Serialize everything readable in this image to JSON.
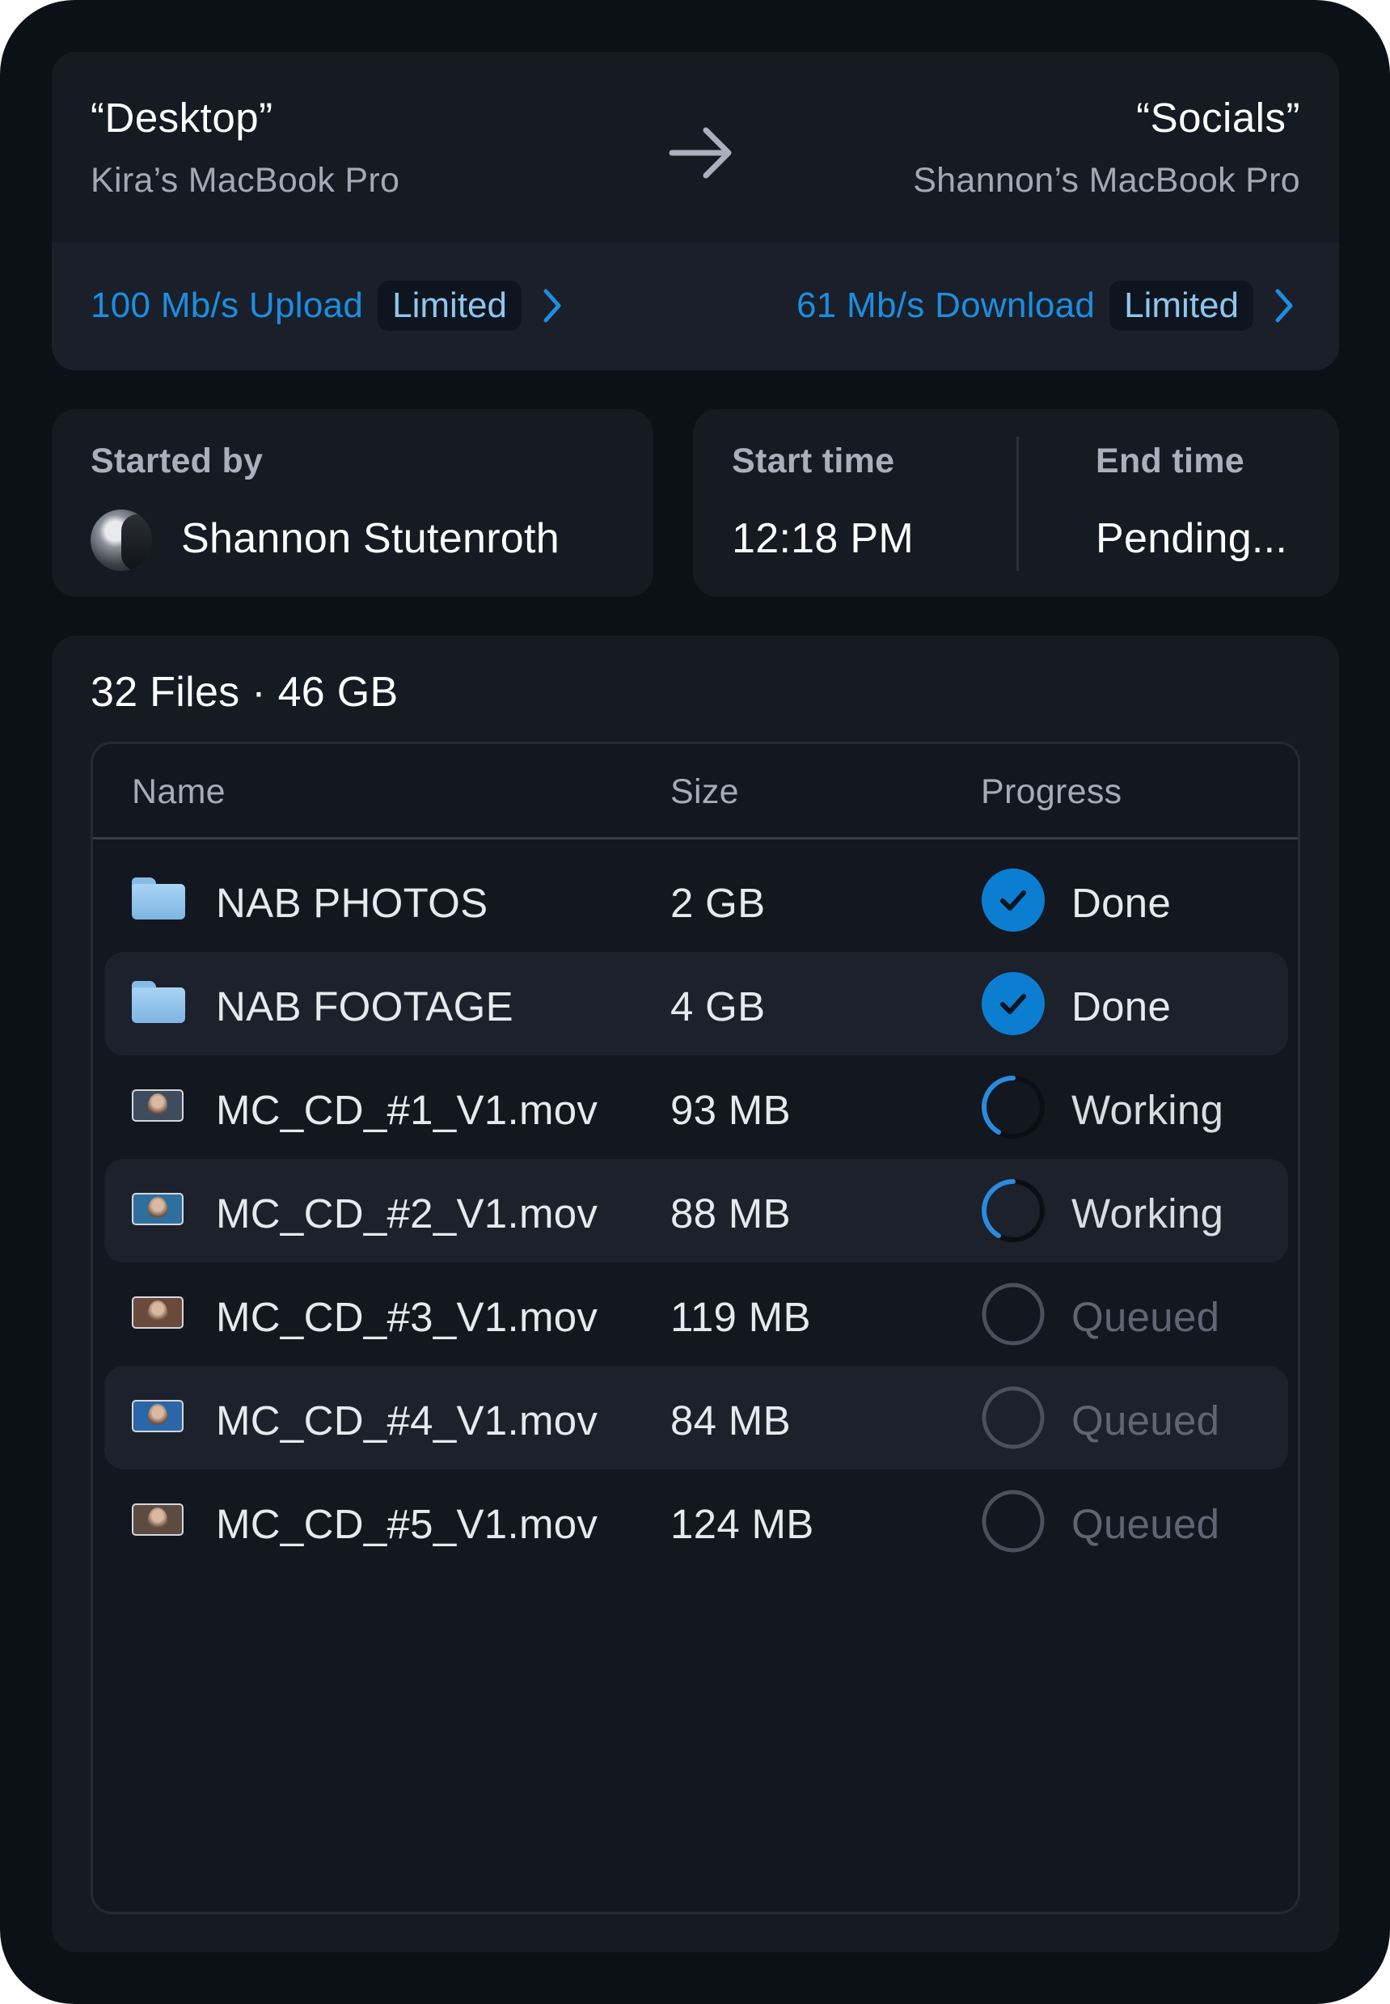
{
  "transfer": {
    "source": {
      "title": "“Desktop”",
      "device": "Kira’s MacBook Pro"
    },
    "destination": {
      "title": "“Socials”",
      "device": "Shannon’s MacBook Pro"
    },
    "upload": {
      "speed": "100 Mb/s Upload",
      "badge": "Limited"
    },
    "download": {
      "speed": "61 Mb/s Download",
      "badge": "Limited"
    }
  },
  "started_by": {
    "label": "Started by",
    "name": "Shannon Stutenroth"
  },
  "times": {
    "start_label": "Start time",
    "start_value": "12:18 PM",
    "end_label": "End time",
    "end_value": "Pending..."
  },
  "files": {
    "summary": "32 Files · 46 GB",
    "columns": {
      "name": "Name",
      "size": "Size",
      "progress": "Progress"
    },
    "rows": [
      {
        "name": "NAB PHOTOS",
        "size": "2 GB",
        "status": "Done",
        "kind": "folder",
        "state": "done"
      },
      {
        "name": "NAB FOOTAGE",
        "size": "4 GB",
        "status": "Done",
        "kind": "folder",
        "state": "done"
      },
      {
        "name": "MC_CD_#1_V1.mov",
        "size": "93 MB",
        "status": "Working",
        "kind": "video",
        "state": "working",
        "thumb": "#3e4c5e"
      },
      {
        "name": "MC_CD_#2_V1.mov",
        "size": "88 MB",
        "status": "Working",
        "kind": "video",
        "state": "working",
        "thumb": "#2f6f9e"
      },
      {
        "name": "MC_CD_#3_V1.mov",
        "size": "119 MB",
        "status": "Queued",
        "kind": "video",
        "state": "queued",
        "thumb": "#6a4a3a"
      },
      {
        "name": "MC_CD_#4_V1.mov",
        "size": "84 MB",
        "status": "Queued",
        "kind": "video",
        "state": "queued",
        "thumb": "#2a66a8"
      },
      {
        "name": "MC_CD_#5_V1.mov",
        "size": "124 MB",
        "status": "Queued",
        "kind": "video",
        "state": "queued",
        "thumb": "#5d4a40"
      }
    ]
  },
  "colors": {
    "accent": "#1c8ee0",
    "done": "#0b7ed2",
    "spinner": "#2a8be0",
    "queued_ring": "#4a515d"
  },
  "icons": {
    "arrow": "arrow-right-icon",
    "chevron": "chevron-right-icon",
    "folder": "folder-icon",
    "video": "video-thumbnail-icon",
    "done": "check-circle-icon",
    "working": "spinner-icon",
    "queued": "empty-circle-icon"
  }
}
